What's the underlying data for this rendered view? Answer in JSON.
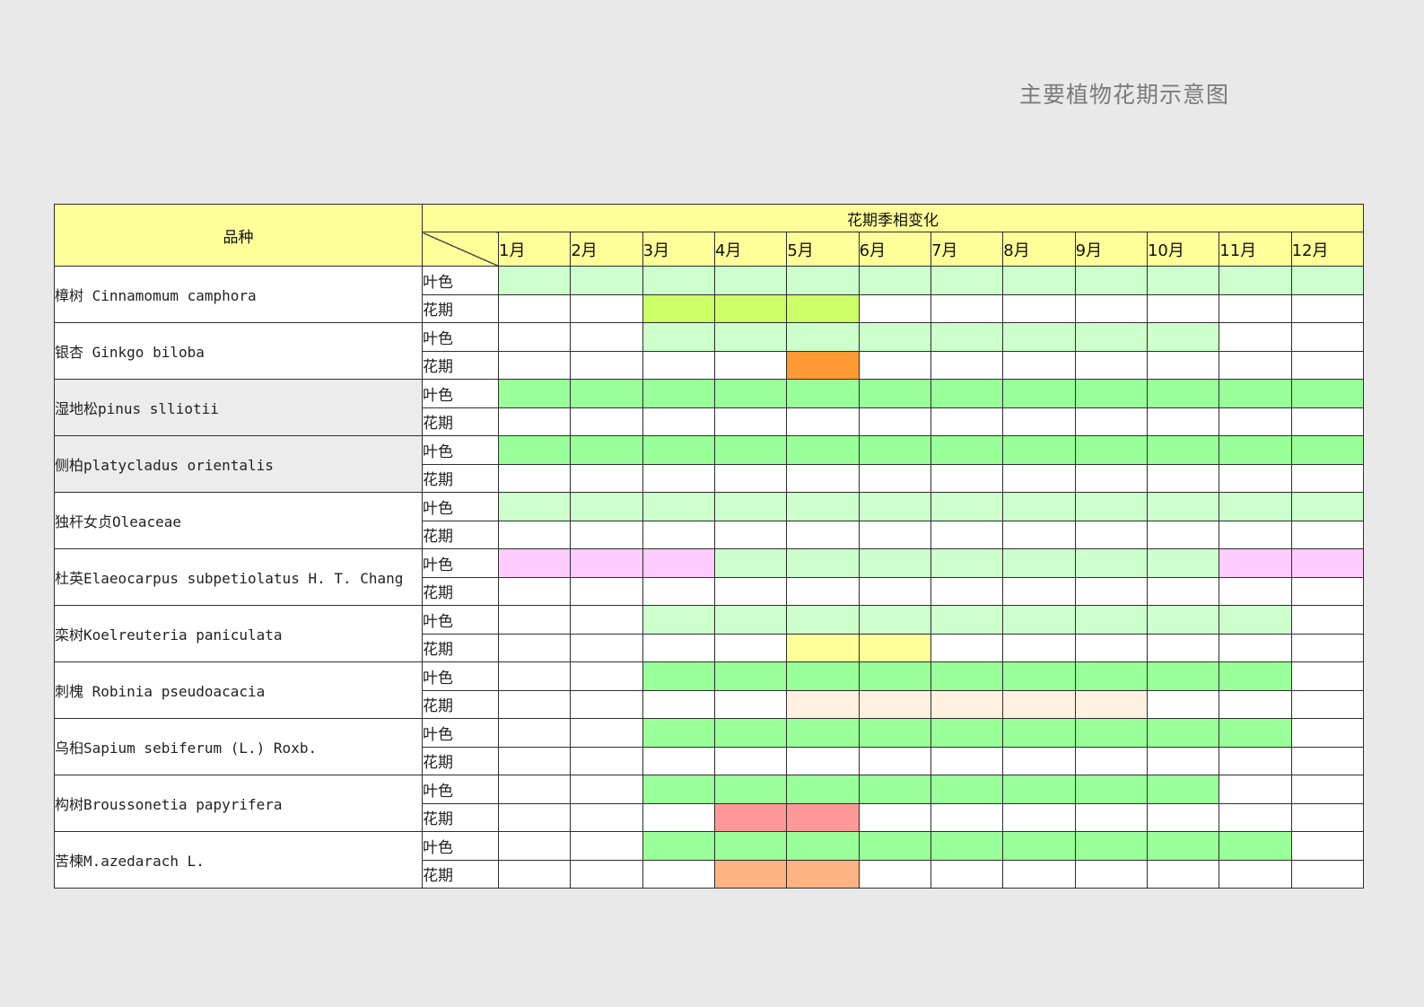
{
  "title": "主要植物花期示意图",
  "header": {
    "species_label": "品种",
    "period_label": "花期季相变化",
    "months": [
      "1月",
      "2月",
      "3月",
      "4月",
      "5月",
      "6月",
      "7月",
      "8月",
      "9月",
      "10月",
      "11月",
      "12月"
    ]
  },
  "row_types": {
    "leaf": "叶色",
    "flower": "花期"
  },
  "colors": {
    "header_bg": "#ffff99",
    "light_green": "#ccffcc",
    "green": "#99ff99",
    "yellow_green": "#ccff66",
    "orange": "#ff9933",
    "pink": "#ffccff",
    "light_yellow": "#ffff99",
    "cream": "#fff0e0",
    "salmon": "#ff9999",
    "peach": "#ffb380",
    "white": "#ffffff",
    "gray": "#ececec"
  },
  "plants": [
    {
      "name": "樟树  Cinnamomum camphora",
      "bg": "white",
      "leaf": [
        "light_green",
        "light_green",
        "light_green",
        "light_green",
        "light_green",
        "light_green",
        "light_green",
        "light_green",
        "light_green",
        "light_green",
        "light_green",
        "light_green"
      ],
      "flower": [
        "white",
        "white",
        "yellow_green",
        "yellow_green",
        "yellow_green",
        "white",
        "white",
        "white",
        "white",
        "white",
        "white",
        "white"
      ]
    },
    {
      "name": "银杏  Ginkgo biloba",
      "bg": "white",
      "leaf": [
        "white",
        "white",
        "light_green",
        "light_green",
        "light_green",
        "light_green",
        "light_green",
        "light_green",
        "light_green",
        "light_green",
        "white",
        "white"
      ],
      "flower": [
        "white",
        "white",
        "white",
        "white",
        "orange",
        "white",
        "white",
        "white",
        "white",
        "white",
        "white",
        "white"
      ]
    },
    {
      "name": "湿地松pinus slliotii",
      "bg": "gray",
      "leaf": [
        "green",
        "green",
        "green",
        "green",
        "green",
        "green",
        "green",
        "green",
        "green",
        "green",
        "green",
        "green"
      ],
      "flower": [
        "white",
        "white",
        "white",
        "white",
        "white",
        "white",
        "white",
        "white",
        "white",
        "white",
        "white",
        "white"
      ]
    },
    {
      "name": "侧柏platycladus orientalis",
      "bg": "gray",
      "leaf": [
        "green",
        "green",
        "green",
        "green",
        "green",
        "green",
        "green",
        "green",
        "green",
        "green",
        "green",
        "green"
      ],
      "flower": [
        "white",
        "white",
        "white",
        "white",
        "white",
        "white",
        "white",
        "white",
        "white",
        "white",
        "white",
        "white"
      ]
    },
    {
      "name": "独杆女贞Oleaceae",
      "bg": "white",
      "leaf": [
        "light_green",
        "light_green",
        "light_green",
        "light_green",
        "light_green",
        "light_green",
        "light_green",
        "light_green",
        "light_green",
        "light_green",
        "light_green",
        "light_green"
      ],
      "flower": [
        "white",
        "white",
        "white",
        "white",
        "white",
        "white",
        "white",
        "white",
        "white",
        "white",
        "white",
        "white"
      ]
    },
    {
      "name": "杜英Elaeocarpus subpetiolatus H. T. Chang",
      "bg": "white",
      "leaf": [
        "pink",
        "pink",
        "pink",
        "light_green",
        "light_green",
        "light_green",
        "light_green",
        "light_green",
        "light_green",
        "light_green",
        "pink",
        "pink"
      ],
      "flower": [
        "white",
        "white",
        "white",
        "white",
        "white",
        "white",
        "white",
        "white",
        "white",
        "white",
        "white",
        "white"
      ]
    },
    {
      "name": "栾树Koelreuteria paniculata",
      "bg": "white",
      "leaf": [
        "white",
        "white",
        "light_green",
        "light_green",
        "light_green",
        "light_green",
        "light_green",
        "light_green",
        "light_green",
        "light_green",
        "light_green",
        "white"
      ],
      "flower": [
        "white",
        "white",
        "white",
        "white",
        "light_yellow",
        "light_yellow",
        "white",
        "white",
        "white",
        "white",
        "white",
        "white"
      ]
    },
    {
      "name": "刺槐 Robinia pseudoacacia",
      "bg": "white",
      "leaf": [
        "white",
        "white",
        "green",
        "green",
        "green",
        "green",
        "green",
        "green",
        "green",
        "green",
        "green",
        "white"
      ],
      "flower": [
        "white",
        "white",
        "white",
        "white",
        "cream",
        "cream",
        "cream",
        "cream",
        "cream",
        "white",
        "white",
        "white"
      ]
    },
    {
      "name": "乌桕Sapium sebiferum (L.) Roxb.",
      "bg": "white",
      "leaf": [
        "white",
        "white",
        "green",
        "green",
        "green",
        "green",
        "green",
        "green",
        "green",
        "green",
        "green",
        "white"
      ],
      "flower": [
        "white",
        "white",
        "white",
        "white",
        "white",
        "white",
        "white",
        "white",
        "white",
        "white",
        "white",
        "white"
      ]
    },
    {
      "name": "构树Broussonetia papyrifera",
      "bg": "white",
      "leaf": [
        "white",
        "white",
        "green",
        "green",
        "green",
        "green",
        "green",
        "green",
        "green",
        "green",
        "white",
        "white"
      ],
      "flower": [
        "white",
        "white",
        "white",
        "salmon",
        "salmon",
        "white",
        "white",
        "white",
        "white",
        "white",
        "white",
        "white"
      ]
    },
    {
      "name": "苦楝M.azedarach L.",
      "bg": "white",
      "leaf": [
        "white",
        "white",
        "green",
        "green",
        "green",
        "green",
        "green",
        "green",
        "green",
        "green",
        "green",
        "white"
      ],
      "flower": [
        "white",
        "white",
        "white",
        "peach",
        "peach",
        "white",
        "white",
        "white",
        "white",
        "white",
        "white",
        "white"
      ]
    }
  ]
}
